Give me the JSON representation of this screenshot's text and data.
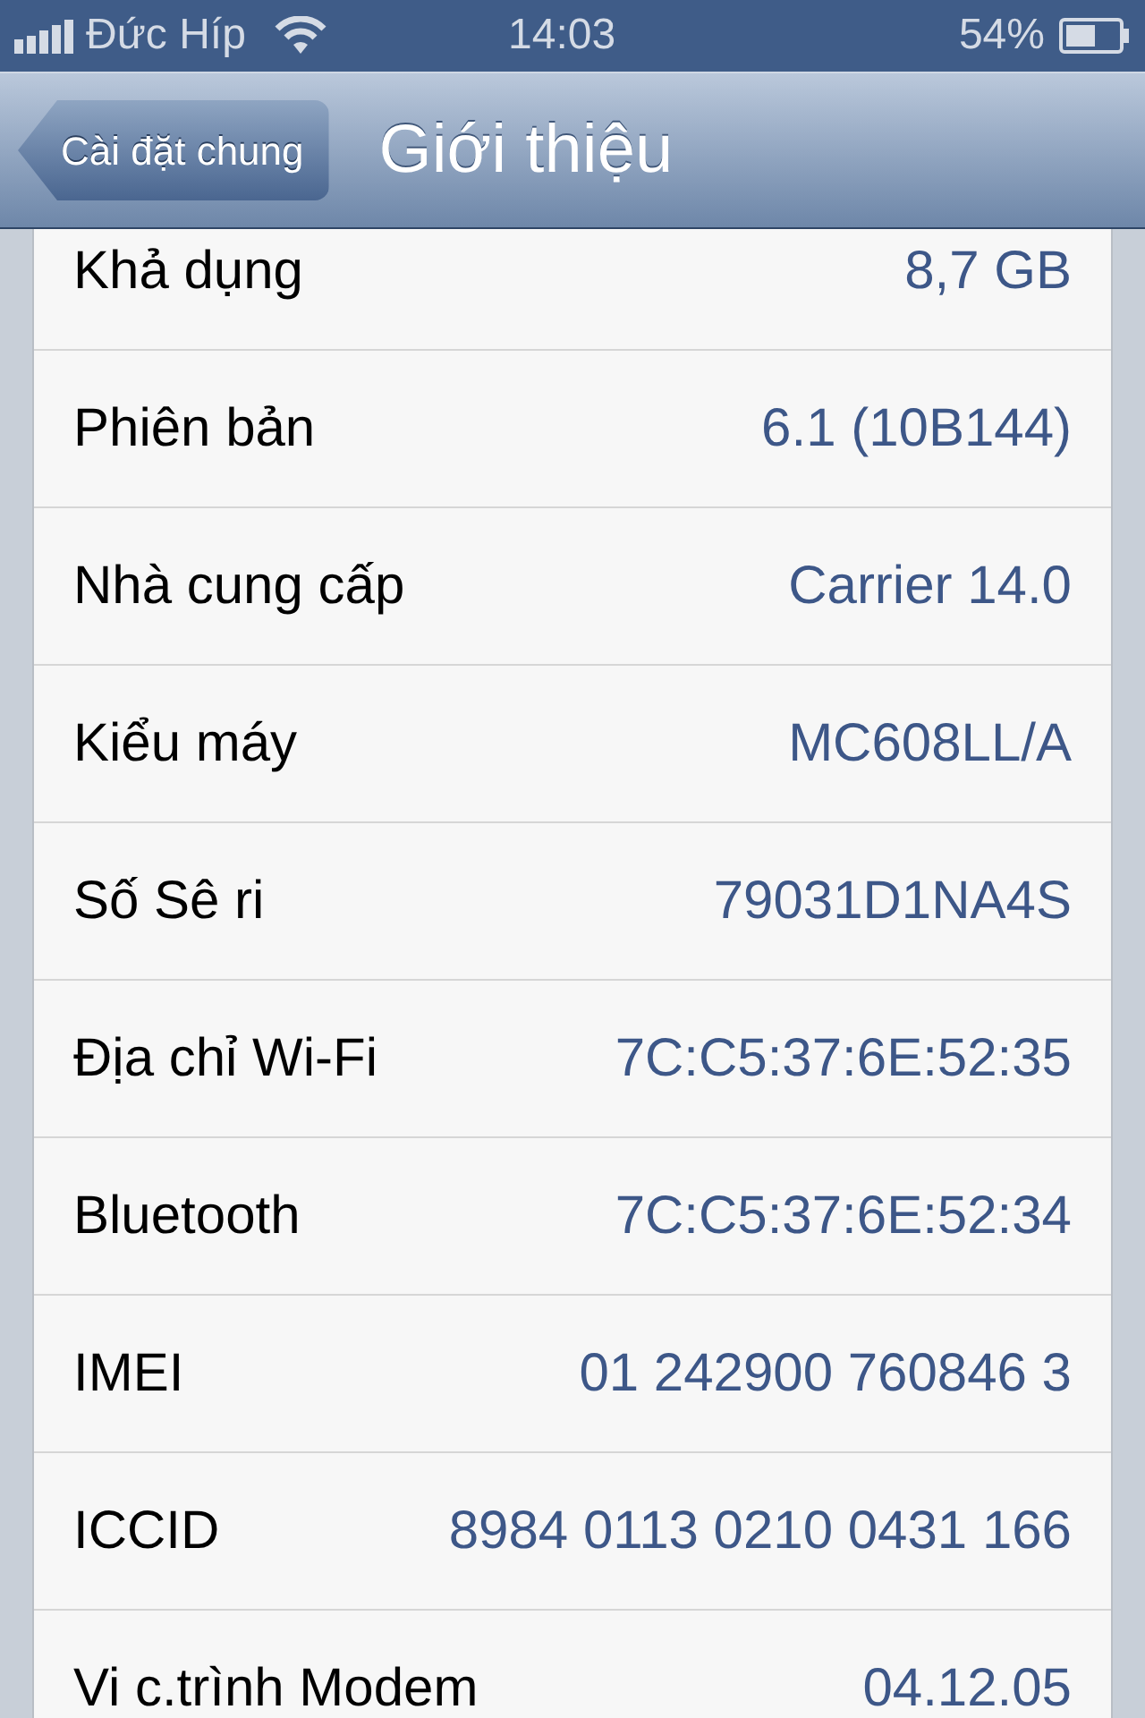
{
  "status_bar": {
    "carrier": "Đức Híp",
    "time": "14:03",
    "battery": "54%"
  },
  "nav_bar": {
    "back": "Cài đặt chung",
    "title": "Giới thiệu"
  },
  "rows": [
    {
      "label": "Khả dụng",
      "value": "8,7 GB"
    },
    {
      "label": "Phiên bản",
      "value": "6.1 (10B144)"
    },
    {
      "label": "Nhà cung cấp",
      "value": "Carrier 14.0"
    },
    {
      "label": "Kiểu máy",
      "value": "MC608LL/A"
    },
    {
      "label": "Số Sê ri",
      "value": "79031D1NA4S"
    },
    {
      "label": "Địa chỉ Wi-Fi",
      "value": "7C:C5:37:6E:52:35"
    },
    {
      "label": "Bluetooth",
      "value": "7C:C5:37:6E:52:34"
    },
    {
      "label": "IMEI",
      "value": "01 242900 760846 3"
    },
    {
      "label": "ICCID",
      "value": "8984 0113 0210 0431 166"
    },
    {
      "label": "Vi c.trình Modem",
      "value": "04.12.05"
    }
  ]
}
